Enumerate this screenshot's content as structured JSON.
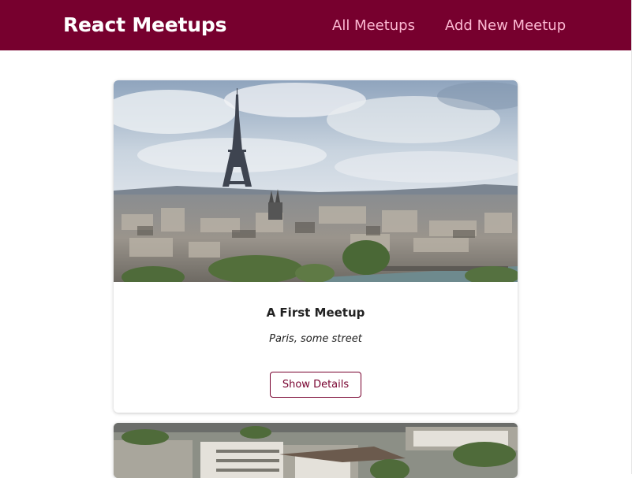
{
  "header": {
    "logo": "React Meetups",
    "nav": [
      {
        "label": "All Meetups"
      },
      {
        "label": "Add New Meetup"
      }
    ]
  },
  "meetups": [
    {
      "title": "A First Meetup",
      "address": "Paris, some street",
      "details_label": "Show Details",
      "image": "city-photo-paris-eiffel-tower"
    },
    {
      "image": "city-photo-buildings"
    }
  ],
  "colors": {
    "header_bg": "#77002e",
    "nav_link": "#fcb8d2",
    "button_border": "#77002e"
  }
}
